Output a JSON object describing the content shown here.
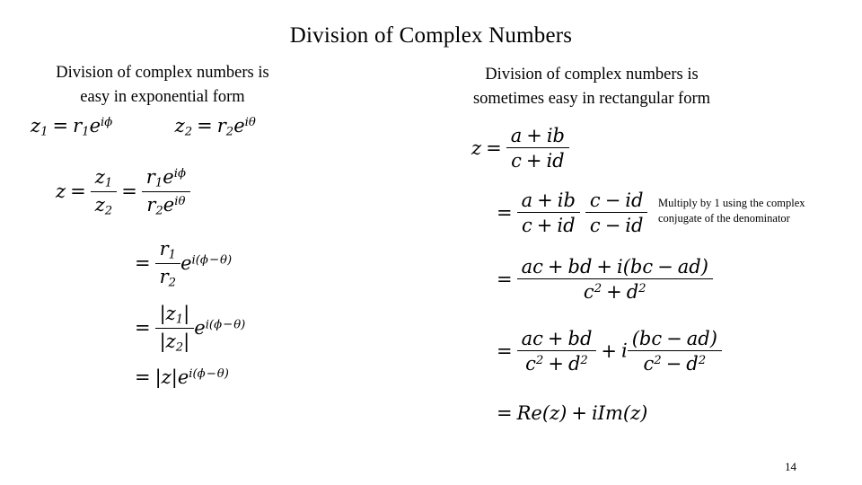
{
  "slide": {
    "title": "Division of Complex Numbers",
    "page_number": "14"
  },
  "columns": {
    "left": {
      "heading_line1": "Division of complex numbers is",
      "heading_line2": "easy in exponential form",
      "equations": {
        "def_z1": {
          "lhs": "z",
          "lhs_sub": "1",
          "equals": "=",
          "r": "r",
          "r_sub": "1",
          "e": "e",
          "exp_i": "i",
          "exp_angle": "ϕ"
        },
        "def_z2": {
          "lhs": "z",
          "lhs_sub": "2",
          "equals": "=",
          "r": "r",
          "r_sub": "2",
          "e": "e",
          "exp_i": "i",
          "exp_angle": "θ"
        },
        "line1": {
          "lead": "z",
          "equals_a": "=",
          "num_a": "z",
          "num_a_sub": "1",
          "den_a": "z",
          "den_a_sub": "2",
          "equals_b": "=",
          "num_b_r": "r",
          "num_b_r_sub": "1",
          "num_b_e": "e",
          "num_b_exp_i": "i",
          "num_b_exp_angle": "ϕ",
          "den_b_r": "r",
          "den_b_r_sub": "2",
          "den_b_e": "e",
          "den_b_exp_i": "i",
          "den_b_exp_angle": "θ"
        },
        "line2": {
          "equals": "=",
          "num": "r",
          "num_sub": "1",
          "den": "r",
          "den_sub": "2",
          "e": "e",
          "exp_i": "i",
          "exp_open": "(",
          "exp_phi": "ϕ",
          "exp_minus": "−",
          "exp_theta": "θ",
          "exp_close": ")"
        },
        "line3": {
          "equals": "=",
          "num": "|z",
          "num_sub": "1",
          "num_end": "|",
          "den": "|z",
          "den_sub": "2",
          "den_end": "|",
          "e": "e",
          "exp_i": "i",
          "exp_open": "(",
          "exp_phi": "ϕ",
          "exp_minus": "−",
          "exp_theta": "θ",
          "exp_close": ")"
        },
        "line4": {
          "equals": "=",
          "modulus": "|z|",
          "e": "e",
          "exp_i": "i",
          "exp_open": "(",
          "exp_phi": "ϕ",
          "exp_minus": "−",
          "exp_theta": "θ",
          "exp_close": ")"
        }
      }
    },
    "right": {
      "heading_line1": "Division of complex numbers is",
      "heading_line2": "sometimes easy in rectangular form",
      "annotation_line1": "Multiply by 1 using the complex",
      "annotation_line2": "conjugate of the denominator",
      "equations": {
        "line1": {
          "lead": "z",
          "equals": "=",
          "num_a": "a",
          "num_op": "+",
          "num_b": "ib",
          "den_c": "c",
          "den_op": "+",
          "den_d": "id"
        },
        "line2": {
          "equals": "=",
          "f1_num_a": "a",
          "f1_num_op": "+",
          "f1_num_b": "ib",
          "f1_den_c": "c",
          "f1_den_op": "+",
          "f1_den_d": "id",
          "f2_num_c": "c",
          "f2_num_op": "−",
          "f2_num_d": "id",
          "f2_den_c": "c",
          "f2_den_op": "−",
          "f2_den_d": "id"
        },
        "line3": {
          "equals": "=",
          "num_ac": "ac",
          "num_op1": "+",
          "num_bd": "bd",
          "num_op2": "+",
          "num_i": "i",
          "num_open": "(",
          "num_bc": "bc",
          "num_op3": "−",
          "num_ad": "ad",
          "num_close": ")",
          "den_c": "c",
          "den_c_exp": "2",
          "den_op": "+",
          "den_d": "d",
          "den_d_exp": "2"
        },
        "line4": {
          "equals": "=",
          "f1_num_ac": "ac",
          "f1_num_op": "+",
          "f1_num_bd": "bd",
          "f1_den_c": "c",
          "f1_den_c_exp": "2",
          "f1_den_op": "+",
          "f1_den_d": "d",
          "f1_den_d_exp": "2",
          "plus": "+",
          "i": "i",
          "f2_num_open": "(",
          "f2_num_bc": "bc",
          "f2_num_op": "−",
          "f2_num_ad": "ad",
          "f2_num_close": ")",
          "f2_den_c": "c",
          "f2_den_c_exp": "2",
          "f2_den_op": "−",
          "f2_den_d": "d",
          "f2_den_d_exp": "2"
        },
        "line5": {
          "equals": "=",
          "re": "Re",
          "re_open": "(",
          "re_z": "z",
          "re_close": ")",
          "plus": "+",
          "i": "i",
          "im": "Im",
          "im_open": "(",
          "im_z": "z",
          "im_close": ")"
        }
      }
    }
  }
}
